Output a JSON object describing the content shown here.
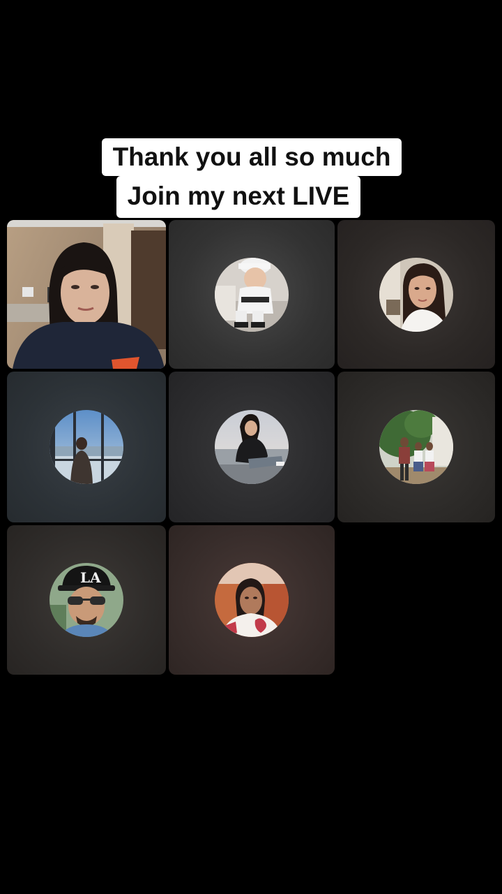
{
  "caption": {
    "line1": "Thank you all so much",
    "line2": "Join my next LIVE"
  },
  "tiles": [
    {
      "name": "host-video",
      "kind": "video",
      "bg": "#6b6157"
    },
    {
      "name": "guest-2",
      "kind": "avatar",
      "icon": "child-with-cap-avatar",
      "bg": "#3a3a3a"
    },
    {
      "name": "guest-3",
      "kind": "avatar",
      "icon": "woman-portrait-avatar",
      "bg": "#2e2a28"
    },
    {
      "name": "guest-4",
      "kind": "avatar",
      "icon": "window-view-avatar",
      "bg": "#2b3035"
    },
    {
      "name": "guest-5",
      "kind": "avatar",
      "icon": "seated-woman-avatar",
      "bg": "#2c2c2e"
    },
    {
      "name": "guest-6",
      "kind": "avatar",
      "icon": "family-garden-avatar",
      "bg": "#2d2b29"
    },
    {
      "name": "guest-7",
      "kind": "avatar",
      "icon": "man-la-cap-avatar",
      "bg": "#2f2c2a"
    },
    {
      "name": "guest-8",
      "kind": "avatar",
      "icon": "woman-red-wall-avatar",
      "bg": "#3a2e2c"
    }
  ],
  "colors": {
    "background": "#000000",
    "caption_bg": "#ffffff",
    "caption_text": "#111111"
  }
}
